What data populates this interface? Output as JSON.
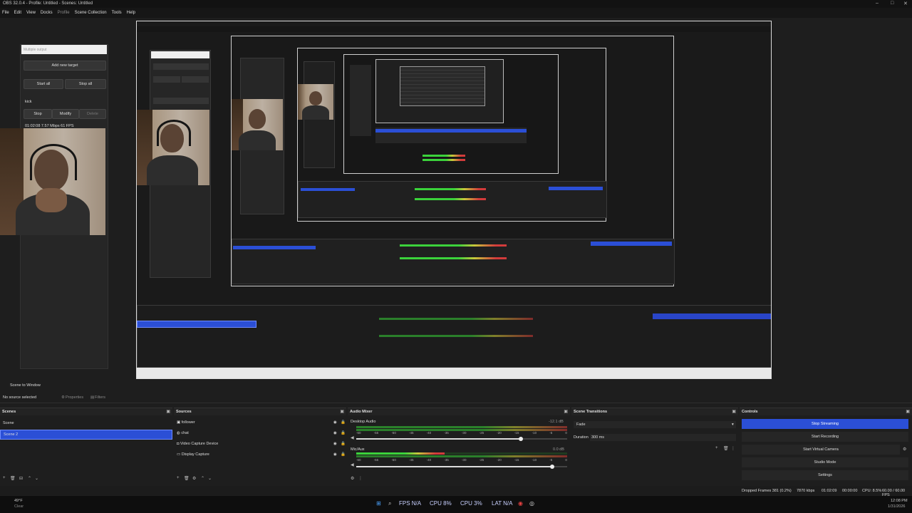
{
  "window": {
    "title": "OBS 32.0.4 - Profile: Untitled - Scenes: Untitled",
    "controls": [
      "–",
      "□",
      "✕"
    ]
  },
  "menu": [
    "File",
    "Edit",
    "View",
    "Docks",
    "Profile",
    "Scene Collection",
    "Tools",
    "Help"
  ],
  "multistream": {
    "input_placeholder": "Multiple output",
    "add_target": "Add new target",
    "start_all": "Start all",
    "stop_all": "Stop all",
    "target_name": "kick",
    "stop": "Stop",
    "modify": "Modify",
    "delete": "Delete",
    "stats": "01:02:08 7.57 Mbps 61 FPS"
  },
  "context_bar": {
    "scene_label": "Scene to Window",
    "no_source": "No source selected",
    "properties": "Properties",
    "filters": "Filters"
  },
  "scenes": {
    "title": "Scenes",
    "items": [
      "Scene",
      "Scene 2"
    ],
    "selected_index": 1
  },
  "sources": {
    "title": "Sources",
    "items": [
      {
        "name": "follower",
        "icon": "image-icon"
      },
      {
        "name": "chat",
        "icon": "browser-icon"
      },
      {
        "name": "Video Capture Device",
        "icon": "camera-icon"
      },
      {
        "name": "Display Capture",
        "icon": "monitor-icon"
      }
    ]
  },
  "audio_mixer": {
    "title": "Audio Mixer",
    "channels": [
      {
        "name": "Desktop Audio",
        "db": "-12.1 dB",
        "volume": 0.78,
        "level": 1.0
      },
      {
        "name": "Mic/Aux",
        "db": "0.0 dB",
        "volume": 0.93,
        "level": 0.42
      }
    ],
    "scale": [
      "-60",
      "-55",
      "-50",
      "-45",
      "-40",
      "-35",
      "-30",
      "-25",
      "-20",
      "-15",
      "-10",
      "-5",
      "0"
    ]
  },
  "transitions": {
    "title": "Scene Transitions",
    "type": "Fade",
    "duration_label": "Duration",
    "duration_value": "300 ms"
  },
  "controls": {
    "title": "Controls",
    "buttons": [
      "Stop Streaming",
      "Start Recording",
      "Start Virtual Camera",
      "Studio Mode",
      "Settings"
    ]
  },
  "status_bar": {
    "dropped": "Dropped Frames 381 (0.2%)",
    "bitrate": "7870 kbps",
    "stream_time": "01:02:09",
    "rec_time": "00:00:00",
    "cpu": "CPU: 8.5%",
    "fps": "60.00 / 60.00 FPS"
  },
  "taskbar": {
    "fps": "FPS N/A",
    "cpu": "CPU 8%",
    "cpu2": "CPU 3%",
    "lat": "LAT N/A",
    "weather": "49°F",
    "weather_sub": "Clear",
    "time": "12:08 PM",
    "date": "1/31/2026"
  },
  "colors": {
    "accent": "#2b4fd6",
    "panel": "#1e1e1e",
    "meter_green": "#3bd23b",
    "meter_yellow": "#c8c83b",
    "meter_red": "#d23b3b"
  }
}
